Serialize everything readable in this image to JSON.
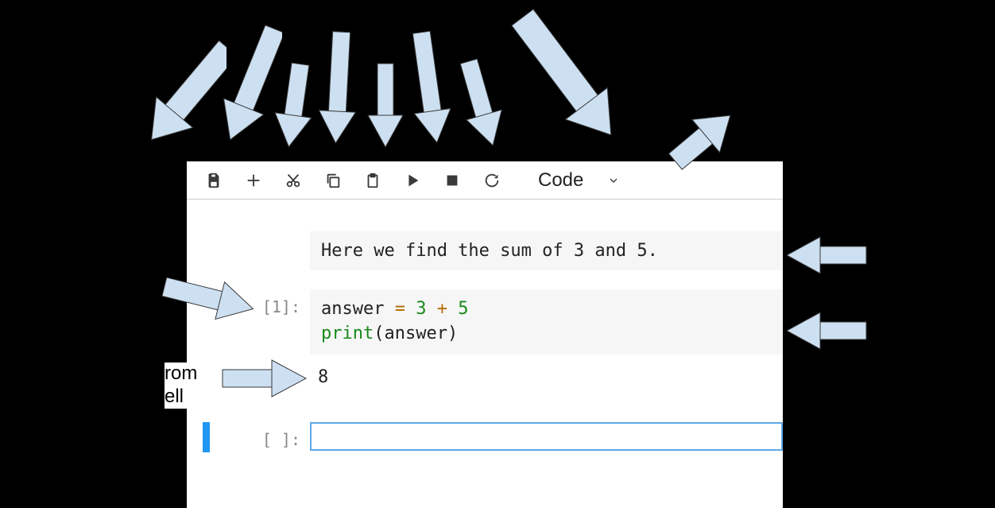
{
  "toolbar": {
    "cell_type_label": "Code"
  },
  "cells": {
    "markdown": {
      "text": "Here we find the sum of 3 and 5."
    },
    "code1": {
      "prompt": "[1]:",
      "line1_var": "answer ",
      "line1_op": "=",
      "line1_rest_a": " 3 ",
      "line1_plus": "+",
      "line1_rest_b": " 5",
      "line2_func": "print",
      "line2_open": "(",
      "line2_arg": "answer",
      "line2_close": ")"
    },
    "output1": {
      "text": "8"
    },
    "code2": {
      "prompt": "[ ]:"
    }
  },
  "cropped_labels": {
    "line1": "rom",
    "line2": "ell"
  },
  "arrow_color": "#cde0f2",
  "arrow_stroke": "#3a3a3a"
}
